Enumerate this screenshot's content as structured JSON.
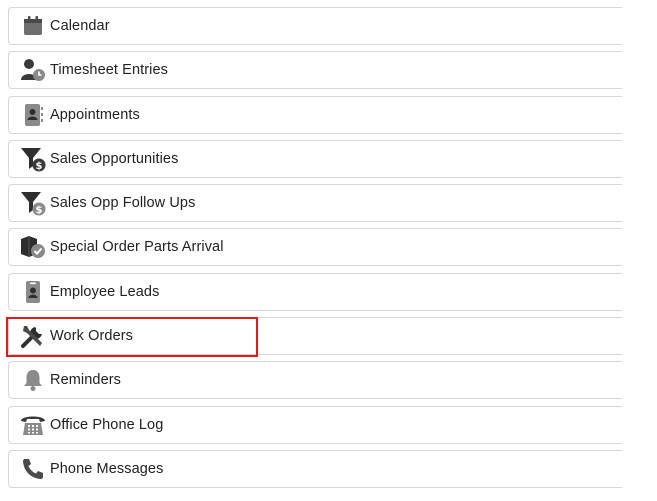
{
  "menu": {
    "items": [
      {
        "label": "Calendar",
        "icon": "calendar-icon"
      },
      {
        "label": "Timesheet Entries",
        "icon": "user-clock-icon"
      },
      {
        "label": "Appointments",
        "icon": "address-book-icon"
      },
      {
        "label": "Sales Opportunities",
        "icon": "funnel-dollar-icon"
      },
      {
        "label": "Sales Opp Follow Ups",
        "icon": "funnel-dollar-icon"
      },
      {
        "label": "Special Order Parts Arrival",
        "icon": "box-check-icon"
      },
      {
        "label": "Employee Leads",
        "icon": "id-badge-icon"
      },
      {
        "label": "Work Orders",
        "icon": "tools-icon"
      },
      {
        "label": "Reminders",
        "icon": "bell-icon"
      },
      {
        "label": "Office Phone Log",
        "icon": "desk-phone-icon"
      },
      {
        "label": "Phone Messages",
        "icon": "phone-icon"
      }
    ]
  },
  "colors": {
    "icon_dark": "#3a3a3a",
    "icon_gray": "#8a8a8a",
    "border": "#d6d6d6",
    "highlight": "#e01b1b"
  }
}
